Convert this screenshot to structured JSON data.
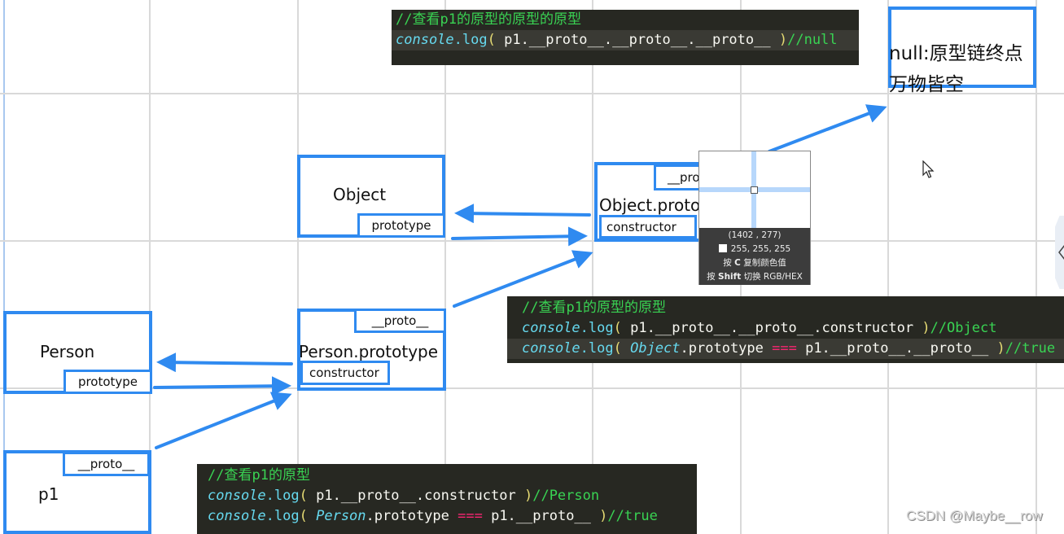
{
  "diagram": {
    "nodes": [
      {
        "id": "object",
        "label": "Object",
        "slot": "prototype"
      },
      {
        "id": "object-prototype",
        "label": "Object.proto",
        "top_slot": "__pro",
        "slot": "constructor"
      },
      {
        "id": "null",
        "label_line1": "null:原型链终点",
        "label_line2": "万物皆空"
      },
      {
        "id": "person",
        "label": "Person",
        "slot": "prototype"
      },
      {
        "id": "person-prototype",
        "label": "Person.prototype",
        "top_slot": "__proto__",
        "slot": "constructor"
      },
      {
        "id": "p1",
        "label": "p1",
        "top_slot": "__proto__"
      }
    ],
    "edges": [
      {
        "from": "object-prototype",
        "to": "object",
        "via": "constructor"
      },
      {
        "from": "object",
        "to": "object-prototype",
        "via": "prototype"
      },
      {
        "from": "object-prototype",
        "to": "null",
        "via": "__proto__"
      },
      {
        "from": "person-prototype",
        "to": "person",
        "via": "constructor"
      },
      {
        "from": "person",
        "to": "person-prototype",
        "via": "prototype"
      },
      {
        "from": "person-prototype",
        "to": "object-prototype",
        "via": "__proto__"
      },
      {
        "from": "p1",
        "to": "person-prototype",
        "via": "__proto__"
      }
    ]
  },
  "code_panels": {
    "top": {
      "comment": "//查看p1的原型的原型的原型",
      "line1": {
        "kw": "console",
        "fn": ".log",
        "open": "(",
        "body": " p1.__proto__.__proto__.__proto__ ",
        "close": ")",
        "result": "//null"
      }
    },
    "middle": {
      "comment": "//查看p1的原型的原型",
      "line1": {
        "kw": "console",
        "fn": ".log",
        "open": "(",
        "body": " p1.__proto__.__proto__.constructor ",
        "close": ")",
        "result": "//Object"
      },
      "line2": {
        "kw": "console",
        "fn": ".log",
        "open": "(",
        "obj": "Object",
        "body_a": ".prototype ",
        "op": "===",
        "body_b": " p1.__proto__.__proto__ ",
        "close": ")",
        "result": "//true"
      }
    },
    "bottom": {
      "comment": "//查看p1的原型",
      "line1": {
        "kw": "console",
        "fn": ".log",
        "open": "(",
        "body": " p1.__proto__.constructor ",
        "close": ")",
        "result": "//Person"
      },
      "line2": {
        "kw": "console",
        "fn": ".log",
        "open": "(",
        "obj": "Person",
        "body_a": ".prototype ",
        "op": "===",
        "body_b": " p1.__proto__ ",
        "close": ")",
        "result": "//true"
      }
    }
  },
  "color_picker": {
    "coords": "(1402 , 277)",
    "rgb": "255, 255, 255",
    "hint_copy_prefix": "按 ",
    "hint_copy_key": "C",
    "hint_copy_suffix": " 复制颜色值",
    "hint_switch_prefix": "按 ",
    "hint_switch_key": "Shift",
    "hint_switch_suffix": " 切换 RGB/HEX"
  },
  "watermark": "CSDN @Maybe__row",
  "colors": {
    "box_border": "#2f8af0",
    "code_bg": "#272822",
    "comment": "#39d353",
    "keyword": "#66d9ef",
    "operator": "#f92672"
  }
}
